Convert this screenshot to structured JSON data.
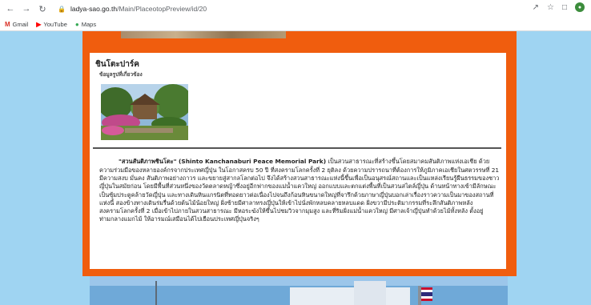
{
  "browser": {
    "url_domain": "ladya-sao.go.th",
    "url_path": "/Main/PlaceotopPreview/id/20",
    "bookmarks": [
      {
        "label": "Gmail",
        "icon": "gmail-icon"
      },
      {
        "label": "YouTube",
        "icon": "youtube-icon"
      },
      {
        "label": "Maps",
        "icon": "maps-icon"
      }
    ]
  },
  "page": {
    "title": "ชินโตะปาร์ค",
    "subtitle": "ข้อมูลรูปที่เกี่ยวข้อง",
    "paragraph_bold": "\"สวนสันติภาพชินโตะ\" (Shinto Kanchanaburi Peace Memorial Park)",
    "paragraph_text": " เป็นสวนสาธารณะที่สร้างขึ้นโดยสมาคมสันติภาพแห่งเอเชีย ด้วยความร่วมมือของหลายองค์กรจากประเทศญี่ปุ่น ในโอกาสครบ 50 ปี ที่สงครามโลกครั้งที่ 2 ยุติลง ด้วยความปรารถนาที่ต้องการให้ภูมิภาคเอเชียในศตวรรษที่ 21 มีความสงบ มั่นคง สันติภาพอย่างถาวร และขยายสู่สากลโลกต่อไป จึงได้สร้างสวนสาธารณะแห่งนี้ขึ้นเพื่อเป็นอนุสรณ์สถานและเป็นแหล่งเรียนรู้ผืนธรรมของชาวญี่ปุ่นในสมัยก่อน โดยมีพื้นที่ส่วนหนึ่งของวัดตลาดหญ้าซึ่งอยู่อีกฟากของแม่น้ำแควใหญ่ ออกแบบและตกแต่งพื้นที่เป็นสวนสไตล์ญี่ปุ่น ด้านหน้าทางเข้ามีลักษณะเป็นซุ้มประตูคล้ายวัดญี่ปุ่น และทางเดินหินแกรนิตที่ทอดยาวต่อเนื่องไปจนถึงก้อนหินขนาดใหญ่ที่จารึกด้วยภาษาญี่ปุ่นบอกเล่าเรื่องราวความเป็นมาของสถานที่แห่งนี้ สองข้างทางเดินร่มรื่นด้วยต้นไม้น้อยใหญ่ ฝั่งซ้ายมีศาลาทรงญี่ปุ่นให้เข้าไปนั่งพักหลบคลายหลบแดด ฝั่งขวามีประติมากรรมที่ระลึกสันติภาพหลังสงครามโลกครั้งที่ 2 เมื่อเข้าไปภายในสวนสาธารณะ มีหอระฆังให้ขึ้นไปชมวิวจากมุมสูง และที่ริมฝั่งแม่น้ำแควใหญ่ มีศาลเจ้าญี่ปุ่นทำด้วยไม้ทั้งหลัง ตั้งอยู่ท่ามกลางแมกไม้ ให้อารมณ์เสมือนได้ไปเยือนประเทศญี่ปุ่นจริงๆ"
  }
}
